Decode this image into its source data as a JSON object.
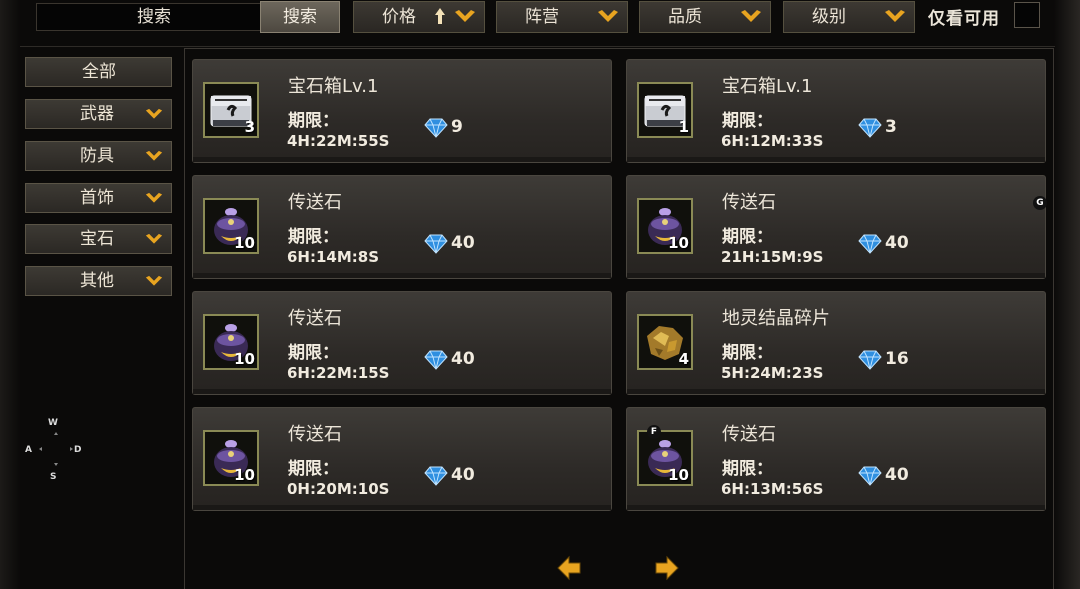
{
  "topbar": {
    "search_value": "搜索",
    "search_button": "搜索",
    "filters": [
      {
        "label": "价格",
        "sort": "ascending"
      },
      {
        "label": "阵营"
      },
      {
        "label": "品质"
      },
      {
        "label": "级别"
      }
    ],
    "only_available_label": "仅看可用"
  },
  "sidebar": {
    "items": [
      {
        "label": "全部"
      },
      {
        "label": "武器"
      },
      {
        "label": "防具"
      },
      {
        "label": "首饰"
      },
      {
        "label": "宝石"
      },
      {
        "label": "其他"
      }
    ]
  },
  "compass": {
    "n": "W",
    "w": "A",
    "e": "D",
    "s": "S"
  },
  "expire_label": "期限：",
  "items": [
    {
      "name": "宝石箱Lv.1",
      "qty": "3",
      "time": "4H:22M:55S",
      "price": "9",
      "icon": "gem-chest-icon"
    },
    {
      "name": "宝石箱Lv.1",
      "qty": "1",
      "time": "6H:12M:33S",
      "price": "3",
      "icon": "gem-chest-icon"
    },
    {
      "name": "传送石",
      "qty": "10",
      "time": "6H:14M:8S",
      "price": "40",
      "icon": "teleport-stone-icon"
    },
    {
      "name": "传送石",
      "qty": "10",
      "time": "21H:15M:9S",
      "price": "40",
      "icon": "teleport-stone-icon"
    },
    {
      "name": "传送石",
      "qty": "10",
      "time": "6H:22M:15S",
      "price": "40",
      "icon": "teleport-stone-icon"
    },
    {
      "name": "地灵结晶碎片",
      "qty": "4",
      "time": "5H:24M:23S",
      "price": "16",
      "icon": "crystal-shard-icon"
    },
    {
      "name": "传送石",
      "qty": "10",
      "time": "0H:20M:10S",
      "price": "40",
      "icon": "teleport-stone-icon"
    },
    {
      "name": "传送石",
      "qty": "10",
      "time": "6H:13M:56S",
      "price": "40",
      "icon": "teleport-stone-icon"
    }
  ],
  "hints": {
    "g": "G",
    "f": "F"
  },
  "colors": {
    "accent": "#e8a420",
    "gem": "#3a9be6",
    "icon_border": "#8a8a55"
  }
}
